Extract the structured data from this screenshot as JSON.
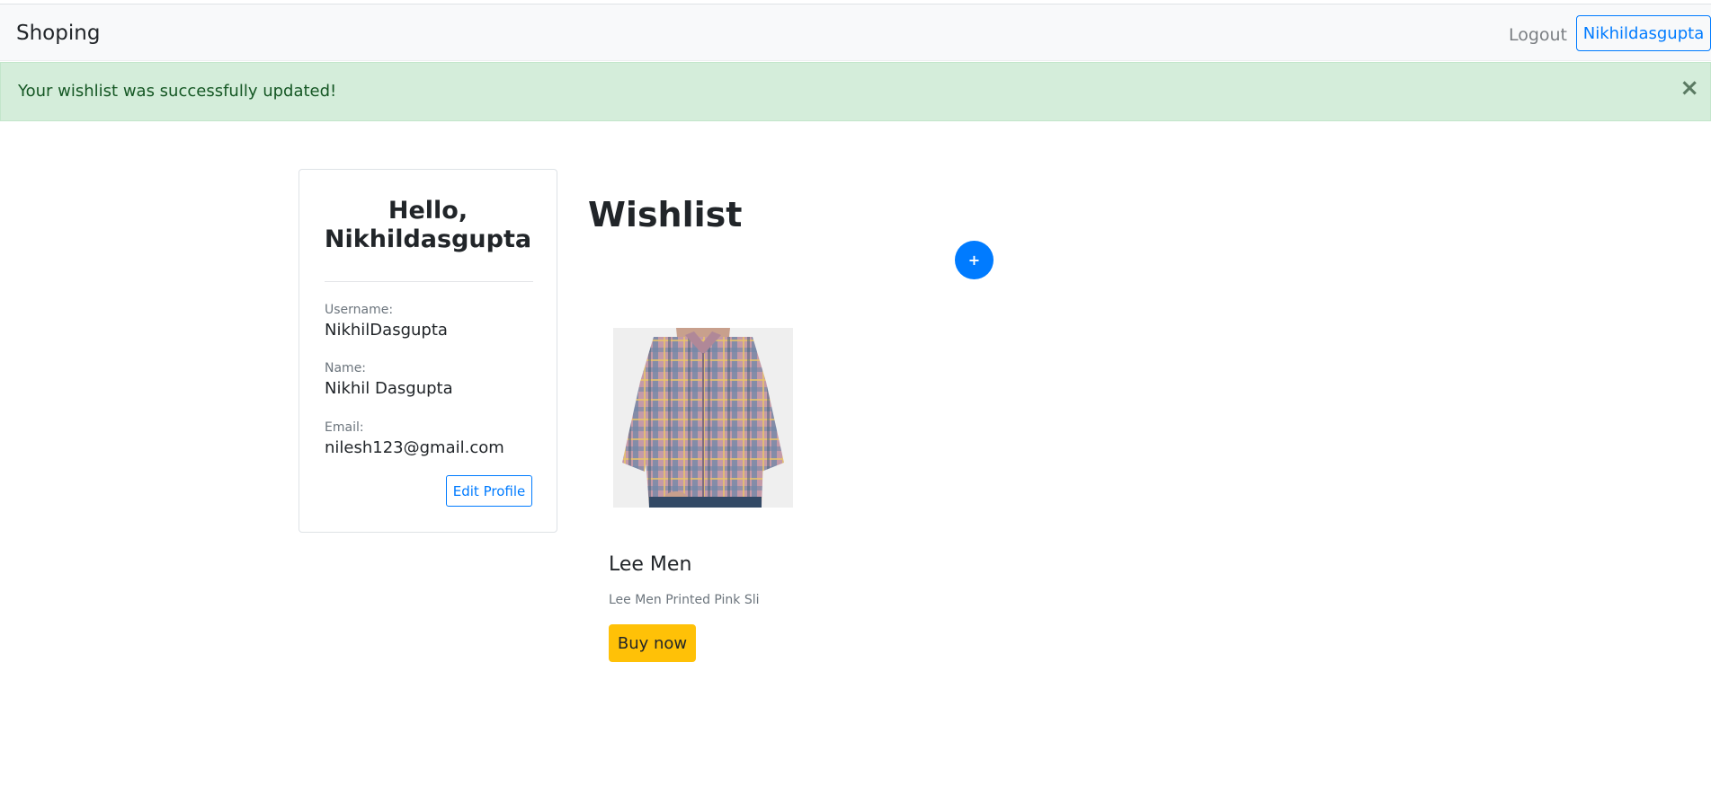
{
  "navbar": {
    "brand": "Shoping",
    "logout": "Logout",
    "user": "Nikhildasgupta"
  },
  "alert": {
    "message": "Your wishlist was successfully updated!",
    "close": "×"
  },
  "profile": {
    "greeting_line1": "Hello,",
    "greeting_line2": "Nikhildasgupta",
    "fields": [
      {
        "label": "Username:",
        "value": "NikhilDasgupta"
      },
      {
        "label": "Name:",
        "value": "Nikhil Dasgupta"
      },
      {
        "label": "Email:",
        "value": "nilesh123@gmail.com"
      }
    ],
    "edit_label": "Edit Profile"
  },
  "wishlist": {
    "title": "Wishlist",
    "add_label": "+",
    "items": [
      {
        "name": "Lee Men",
        "description": "Lee Men Printed Pink Sli",
        "buy_label": "Buy now"
      }
    ]
  },
  "colors": {
    "primary": "#007bff",
    "success_bg": "#d4edda",
    "warning": "#ffc107"
  }
}
